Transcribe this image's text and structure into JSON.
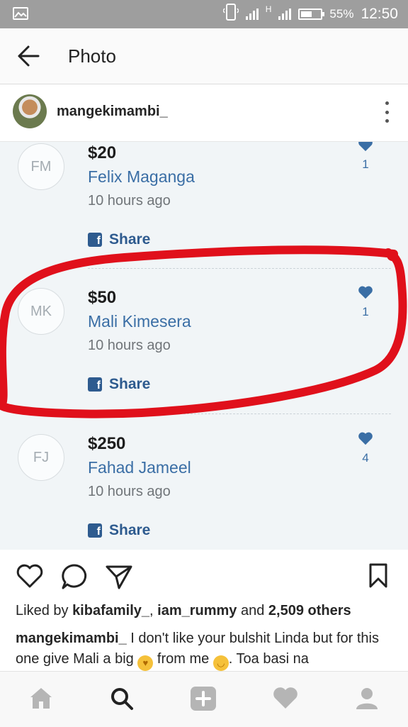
{
  "status_bar": {
    "network": "H",
    "battery_level": 55,
    "battery": "55%",
    "time": "12:50",
    "icons": [
      "gallery-icon",
      "vibrate-icon",
      "signal-icon",
      "battery-icon"
    ]
  },
  "header": {
    "title": "Photo",
    "back_icon": "arrow-left-icon"
  },
  "post": {
    "username": "mangekimambi_",
    "more_icon": "vertical-dots-icon"
  },
  "donations": [
    {
      "initials": "FM",
      "amount": "$20",
      "name": "Felix Maganga",
      "time": "10 hours ago",
      "share": "Share",
      "likes": "1"
    },
    {
      "initials": "MK",
      "amount": "$50",
      "name": "Mali Kimesera",
      "time": "10 hours ago",
      "share": "Share",
      "likes": "1"
    },
    {
      "initials": "FJ",
      "amount": "$250",
      "name": "Fahad Jameel",
      "time": "10 hours ago",
      "share": "Share",
      "likes": "4"
    }
  ],
  "colors": {
    "link": "#3a6ea5",
    "share": "#2e5b8f",
    "annotation": "#e0101b"
  },
  "actions": [
    "heart-icon",
    "comment-icon",
    "send-icon",
    "bookmark-icon"
  ],
  "likes": {
    "prefix": "Liked by ",
    "user1": "kibafamily_",
    "sep": ", ",
    "user2": "iam_rummy",
    "and": " and ",
    "others": "2,509 others"
  },
  "caption": {
    "username": "mangekimambi_",
    "text1": " I don't like your bulshit Linda but for this one give Mali a big ",
    "text2": " from me ",
    "text3": ". Toa basi na"
  },
  "bottom_nav": [
    "home-icon",
    "search-icon",
    "add-post-icon",
    "activity-heart-icon",
    "profile-icon"
  ]
}
